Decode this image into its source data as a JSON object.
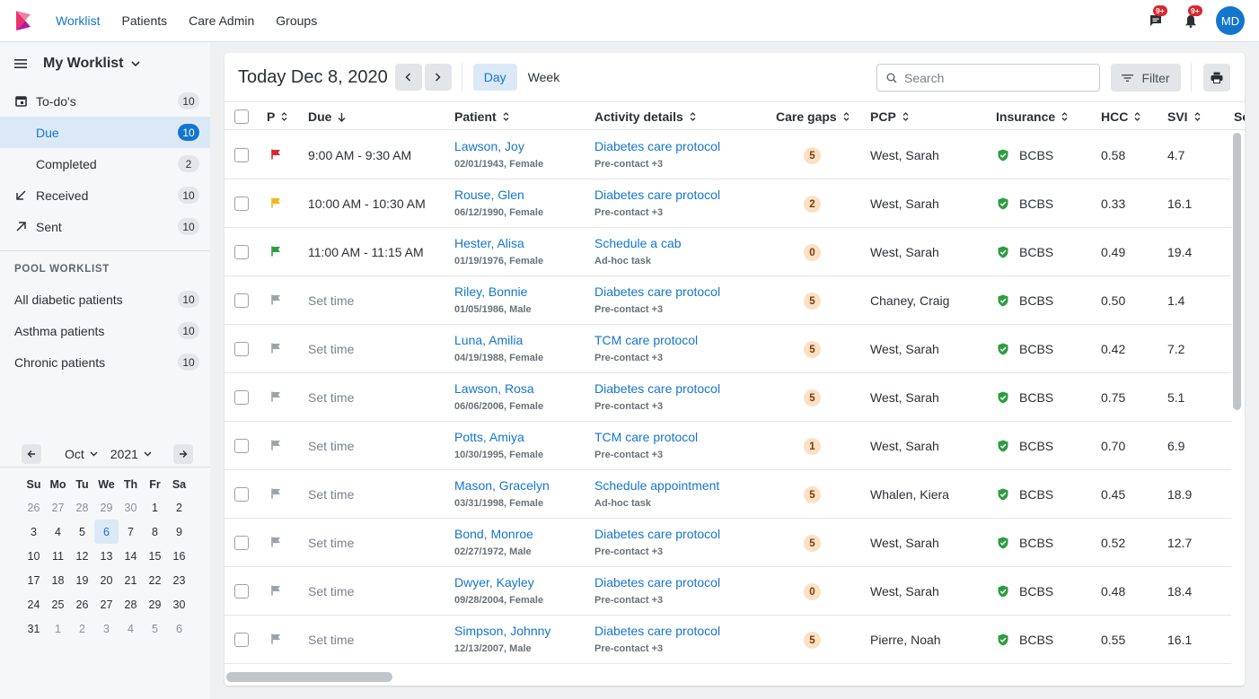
{
  "nav": {
    "items": [
      {
        "label": "Worklist",
        "active": true
      },
      {
        "label": "Patients"
      },
      {
        "label": "Care Admin"
      },
      {
        "label": "Groups"
      }
    ],
    "messages_badge": "9+",
    "notifications_badge": "9+",
    "avatar_initials": "MD"
  },
  "sidebar": {
    "title": "My Worklist",
    "items": [
      {
        "label": "To-do's",
        "count": "10",
        "icon": "calendar-icon"
      },
      {
        "label": "Due",
        "count": "10",
        "active": true
      },
      {
        "label": "Completed",
        "count": "2"
      },
      {
        "label": "Received",
        "count": "10",
        "icon": "arrow-down-left-icon"
      },
      {
        "label": "Sent",
        "count": "10",
        "icon": "arrow-up-right-icon"
      }
    ],
    "pool_title": "POOL WORKLIST",
    "pool_items": [
      {
        "label": "All diabetic patients",
        "count": "10"
      },
      {
        "label": "Asthma patients",
        "count": "10"
      },
      {
        "label": "Chronic patients",
        "count": "10"
      }
    ]
  },
  "calendar": {
    "month": "Oct",
    "year": "2021",
    "weekdays": [
      "Su",
      "Mo",
      "Tu",
      "We",
      "Th",
      "Fr",
      "Sa"
    ],
    "days": [
      [
        "26",
        "27",
        "28",
        "29",
        "30",
        "1",
        "2"
      ],
      [
        "3",
        "4",
        "5",
        "6",
        "7",
        "8",
        "9"
      ],
      [
        "10",
        "11",
        "12",
        "13",
        "14",
        "15",
        "16"
      ],
      [
        "17",
        "18",
        "19",
        "20",
        "21",
        "22",
        "23"
      ],
      [
        "24",
        "25",
        "26",
        "27",
        "28",
        "29",
        "30"
      ],
      [
        "31",
        "1",
        "2",
        "3",
        "4",
        "5",
        "6"
      ]
    ],
    "selected_day": "6"
  },
  "toolbar": {
    "date_title": "Today Dec 8, 2020",
    "view_day": "Day",
    "view_week": "Week",
    "search_placeholder": "Search",
    "filter_label": "Filter"
  },
  "table": {
    "headers": {
      "priority": "P",
      "due": "Due",
      "patient": "Patient",
      "activity": "Activity details",
      "care_gaps": "Care gaps",
      "pcp": "PCP",
      "insurance": "Insurance",
      "hcc": "HCC",
      "svi": "SVI",
      "next": "Sc"
    },
    "rows": [
      {
        "flag": "#d9262f",
        "due": "9:00 AM - 9:30 AM",
        "due_set": true,
        "name": "Lawson, Joy",
        "meta": "02/01/1943, Female",
        "activity": "Diabetes care protocol",
        "sub": "Pre-contact +3",
        "gaps": "5",
        "pcp": "West, Sarah",
        "insurance": "BCBS",
        "hcc": "0.58",
        "svi": "4.7"
      },
      {
        "flag": "#f2b61c",
        "due": "10:00 AM - 10:30 AM",
        "due_set": true,
        "name": "Rouse, Glen",
        "meta": "06/12/1990, Female",
        "activity": "Diabetes care protocol",
        "sub": "Pre-contact +3",
        "gaps": "2",
        "pcp": "West, Sarah",
        "insurance": "BCBS",
        "hcc": "0.33",
        "svi": "16.1"
      },
      {
        "flag": "#2e9d42",
        "due": "11:00 AM - 11:15 AM",
        "due_set": true,
        "name": "Hester, Alisa",
        "meta": "01/19/1976, Female",
        "activity": "Schedule a cab",
        "sub": "Ad-hoc task",
        "gaps": "0",
        "pcp": "West, Sarah",
        "insurance": "BCBS",
        "hcc": "0.49",
        "svi": "19.4"
      },
      {
        "flag": "#9ca2a8",
        "due": "Set time",
        "due_set": false,
        "name": "Riley, Bonnie",
        "meta": "01/05/1986, Male",
        "activity": "Diabetes care protocol",
        "sub": "Pre-contact +3",
        "gaps": "5",
        "pcp": "Chaney, Craig",
        "insurance": "BCBS",
        "hcc": "0.50",
        "svi": "1.4"
      },
      {
        "flag": "#9ca2a8",
        "due": "Set time",
        "due_set": false,
        "name": "Luna, Amilia",
        "meta": "04/19/1988, Female",
        "activity": "TCM care protocol",
        "sub": "Pre-contact +3",
        "gaps": "5",
        "pcp": "West, Sarah",
        "insurance": "BCBS",
        "hcc": "0.42",
        "svi": "7.2"
      },
      {
        "flag": "#9ca2a8",
        "due": "Set time",
        "due_set": false,
        "name": "Lawson, Rosa",
        "meta": "06/06/2006, Female",
        "activity": "Diabetes care protocol",
        "sub": "Pre-contact +3",
        "gaps": "5",
        "pcp": "West, Sarah",
        "insurance": "BCBS",
        "hcc": "0.75",
        "svi": "5.1"
      },
      {
        "flag": "#9ca2a8",
        "due": "Set time",
        "due_set": false,
        "name": "Potts, Amiya",
        "meta": "10/30/1995, Female",
        "activity": "TCM care protocol",
        "sub": "Pre-contact +3",
        "gaps": "1",
        "pcp": "West, Sarah",
        "insurance": "BCBS",
        "hcc": "0.70",
        "svi": "6.9"
      },
      {
        "flag": "#9ca2a8",
        "due": "Set time",
        "due_set": false,
        "name": "Mason, Gracelyn",
        "meta": "03/31/1998, Female",
        "activity": "Schedule appointment",
        "sub": "Ad-hoc task",
        "gaps": "5",
        "pcp": "Whalen, Kiera",
        "insurance": "BCBS",
        "hcc": "0.45",
        "svi": "18.9"
      },
      {
        "flag": "#9ca2a8",
        "due": "Set time",
        "due_set": false,
        "name": "Bond, Monroe",
        "meta": "02/27/1972, Male",
        "activity": "Diabetes care protocol",
        "sub": "Pre-contact +3",
        "gaps": "5",
        "pcp": "West, Sarah",
        "insurance": "BCBS",
        "hcc": "0.52",
        "svi": "12.7"
      },
      {
        "flag": "#9ca2a8",
        "due": "Set time",
        "due_set": false,
        "name": "Dwyer, Kayley",
        "meta": "09/28/2004, Female",
        "activity": "Diabetes care protocol",
        "sub": "Pre-contact +3",
        "gaps": "0",
        "pcp": "West, Sarah",
        "insurance": "BCBS",
        "hcc": "0.48",
        "svi": "18.4"
      },
      {
        "flag": "#9ca2a8",
        "due": "Set time",
        "due_set": false,
        "name": "Simpson, Johnny",
        "meta": "12/13/2007, Male",
        "activity": "Diabetes care protocol",
        "sub": "Pre-contact +3",
        "gaps": "5",
        "pcp": "Pierre, Noah",
        "insurance": "BCBS",
        "hcc": "0.55",
        "svi": "16.1"
      }
    ]
  },
  "colors": {
    "accent": "#1475cf",
    "insured_shield": "#2e9d42"
  }
}
